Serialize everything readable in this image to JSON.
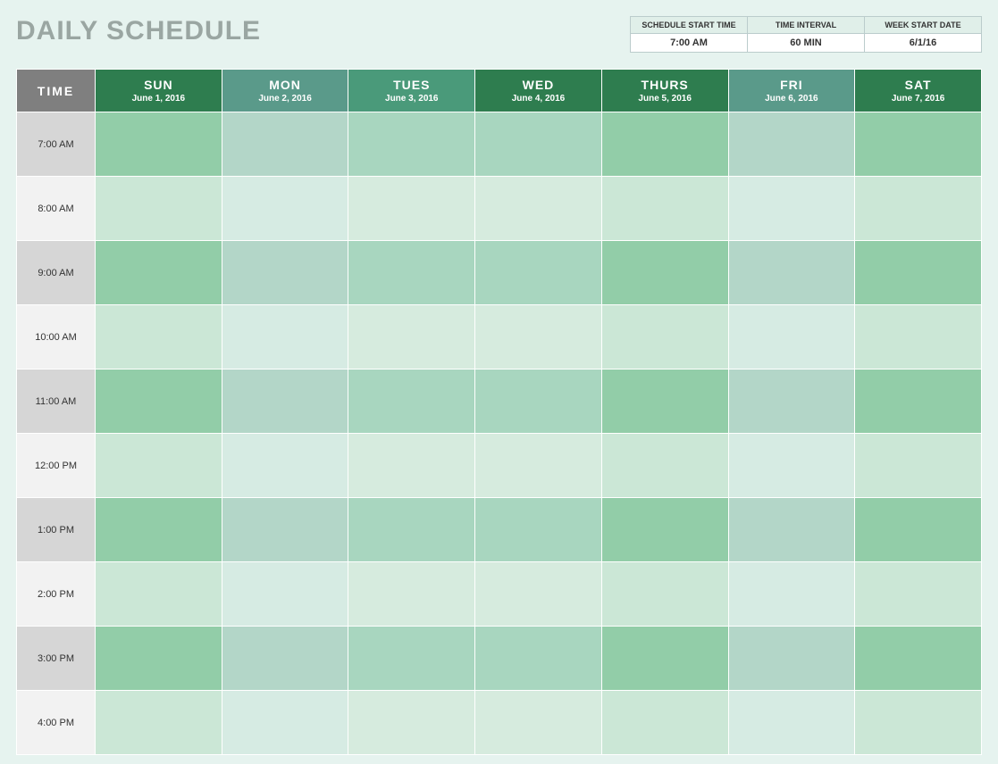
{
  "title": "DAILY SCHEDULE",
  "config": [
    {
      "label": "SCHEDULE START TIME",
      "value": "7:00 AM"
    },
    {
      "label": "TIME INTERVAL",
      "value": "60 MIN"
    },
    {
      "label": "WEEK START DATE",
      "value": "6/1/16"
    }
  ],
  "timeHeader": "TIME",
  "days": [
    {
      "name": "SUN",
      "date": "June 1, 2016",
      "hdr": "hdr-sun"
    },
    {
      "name": "MON",
      "date": "June 2, 2016",
      "hdr": "hdr-mon"
    },
    {
      "name": "TUES",
      "date": "June 3, 2016",
      "hdr": "hdr-tues"
    },
    {
      "name": "WED",
      "date": "June 4, 2016",
      "hdr": "hdr-wed"
    },
    {
      "name": "THURS",
      "date": "June 5, 2016",
      "hdr": "hdr-thurs"
    },
    {
      "name": "FRI",
      "date": "June 6, 2016",
      "hdr": "hdr-fri"
    },
    {
      "name": "SAT",
      "date": "June 7, 2016",
      "hdr": "hdr-sat"
    }
  ],
  "times": [
    "7:00 AM",
    "8:00 AM",
    "9:00 AM",
    "10:00 AM",
    "11:00 AM",
    "12:00 PM",
    "1:00 PM",
    "2:00 PM",
    "3:00 PM",
    "4:00 PM"
  ],
  "chart_data": {
    "type": "table",
    "title": "DAILY SCHEDULE",
    "columns": [
      "TIME",
      "SUN",
      "MON",
      "TUES",
      "WED",
      "THURS",
      "FRI",
      "SAT"
    ],
    "dates": [
      "June 1, 2016",
      "June 2, 2016",
      "June 3, 2016",
      "June 4, 2016",
      "June 5, 2016",
      "June 6, 2016",
      "June 7, 2016"
    ],
    "rows": [
      [
        "7:00 AM",
        "",
        "",
        "",
        "",
        "",
        "",
        ""
      ],
      [
        "8:00 AM",
        "",
        "",
        "",
        "",
        "",
        "",
        ""
      ],
      [
        "9:00 AM",
        "",
        "",
        "",
        "",
        "",
        "",
        ""
      ],
      [
        "10:00 AM",
        "",
        "",
        "",
        "",
        "",
        "",
        ""
      ],
      [
        "11:00 AM",
        "",
        "",
        "",
        "",
        "",
        "",
        ""
      ],
      [
        "12:00 PM",
        "",
        "",
        "",
        "",
        "",
        "",
        ""
      ],
      [
        "1:00 PM",
        "",
        "",
        "",
        "",
        "",
        "",
        ""
      ],
      [
        "2:00 PM",
        "",
        "",
        "",
        "",
        "",
        "",
        ""
      ],
      [
        "3:00 PM",
        "",
        "",
        "",
        "",
        "",
        "",
        ""
      ],
      [
        "4:00 PM",
        "",
        "",
        "",
        "",
        "",
        "",
        ""
      ]
    ]
  }
}
